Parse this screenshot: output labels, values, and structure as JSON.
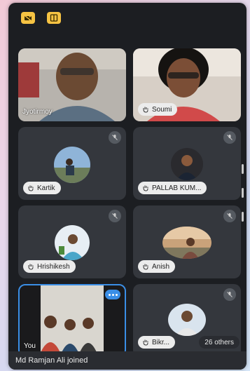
{
  "toolbar": {
    "icons": [
      "camera-off-icon",
      "switch-camera-icon"
    ],
    "accent": "#f6c343"
  },
  "participants": [
    {
      "name": "Jyotirmoy",
      "video": true,
      "muted": false,
      "hand_raised": false
    },
    {
      "name": "Soumi",
      "video": true,
      "muted": false,
      "hand_raised": true
    },
    {
      "name": "Kartik",
      "video": false,
      "muted": true,
      "hand_raised": true
    },
    {
      "name": "PALLAB KUM...",
      "video": false,
      "muted": true,
      "hand_raised": true
    },
    {
      "name": "Hrishikesh",
      "video": false,
      "muted": true,
      "hand_raised": true
    },
    {
      "name": "Anish",
      "video": false,
      "muted": true,
      "hand_raised": true
    },
    {
      "name": "You",
      "video": true,
      "muted": false,
      "hand_raised": false,
      "speaking": true
    },
    {
      "name": "Bikr...",
      "video": false,
      "muted": true,
      "hand_raised": true
    }
  ],
  "others_badge": "26 others",
  "notification": "Md Ramjan Ali joined"
}
